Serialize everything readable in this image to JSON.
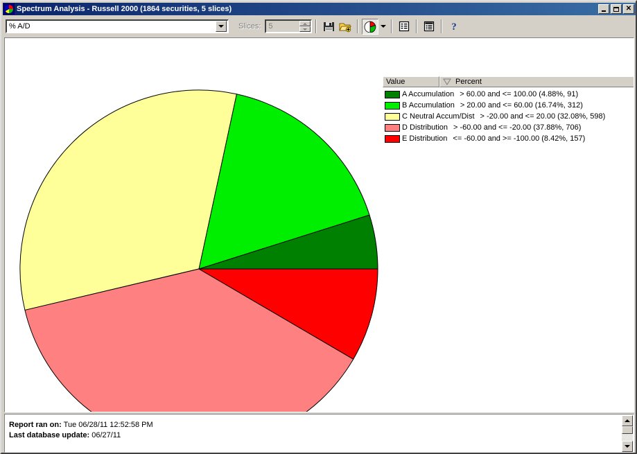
{
  "window": {
    "title": "Spectrum Analysis - Russell 2000 (1864 securities, 5 slices)",
    "icon": "pie-chart-icon",
    "minimize_label": "Minimize",
    "maximize_label": "Maximize",
    "close_label": "Close"
  },
  "toolbar": {
    "indicator_value": "% A/D",
    "indicator_placeholder": "% A/D",
    "slices_label": "Slices:",
    "slices_value": "5",
    "buttons": [
      {
        "name": "save-icon",
        "tip": "Save"
      },
      {
        "name": "open-folder-add-icon",
        "tip": "Open"
      },
      {
        "name": "pie-chart-icon",
        "tip": "Pie Chart"
      },
      {
        "name": "chevron-down-icon",
        "tip": "Chart Type"
      },
      {
        "name": "list-view-icon",
        "tip": "List View"
      },
      {
        "name": "report-view-icon",
        "tip": "Report View"
      },
      {
        "name": "help-icon",
        "tip": "Help"
      }
    ]
  },
  "legend": {
    "columns": [
      "Value",
      "Percent"
    ],
    "sort_column": "Percent",
    "sort_direction": "descending",
    "rows": [
      {
        "color": "#008000",
        "label": "A Accumulation",
        "range": "> 60.00 and <= 100.00 (4.88%, 91)"
      },
      {
        "color": "#00ee00",
        "label": "B Accumulation",
        "range": "> 20.00 and <= 60.00 (16.74%, 312)"
      },
      {
        "color": "#ffff99",
        "label": "C Neutral Accum/Dist",
        "range": "> -20.00 and <= 20.00 (32.08%, 598)"
      },
      {
        "color": "#ff8080",
        "label": "D Distribution",
        "range": "> -60.00 and <= -20.00 (37.88%, 706)"
      },
      {
        "color": "#ff0000",
        "label": "E Distribution",
        "range": "<= -60.00 and >= -100.00 (8.42%, 157)"
      }
    ]
  },
  "report": {
    "ran_on_label": "Report ran on:",
    "ran_on_value": "Tue 06/28/11 12:52:58 PM",
    "updated_label": "Last database update:",
    "updated_value": "06/27/11"
  },
  "chart_data": {
    "type": "pie",
    "title": "Spectrum Analysis - Russell 2000",
    "total_securities": 1864,
    "slice_count": 5,
    "start_angle_deg": 0,
    "direction": "counterclockwise",
    "center": [
      280,
      328
    ],
    "radius": 258,
    "categories": [
      "A Accumulation",
      "B Accumulation",
      "C Neutral Accum/Dist",
      "D Distribution",
      "E Distribution"
    ],
    "values": [
      4.88,
      16.74,
      32.08,
      37.88,
      8.42
    ],
    "counts": [
      91,
      312,
      598,
      706,
      157
    ],
    "colors": [
      "#008000",
      "#00ee00",
      "#ffff99",
      "#ff8080",
      "#ff0000"
    ],
    "ranges": [
      "> 60.00 and <= 100.00",
      "> 20.00 and <= 60.00",
      "> -20.00 and <= 20.00",
      "> -60.00 and <= -20.00",
      "<= -60.00 and >= -100.00"
    ],
    "ylabel": "Percent",
    "xlabel": "Value",
    "legend_position": "top-right"
  }
}
